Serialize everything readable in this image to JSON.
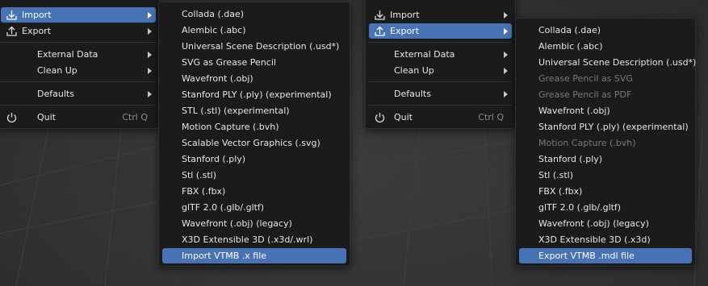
{
  "colors": {
    "highlight": "#4772b3",
    "menu_bg": "#1b1b1b",
    "disabled_text": "#7a7a7a"
  },
  "file_menu_left": {
    "items": [
      {
        "label": "Import",
        "icon": "import-icon"
      },
      {
        "label": "Export",
        "icon": "export-icon"
      },
      {
        "label": "External Data"
      },
      {
        "label": "Clean Up"
      },
      {
        "label": "Defaults"
      },
      {
        "label": "Quit",
        "icon": "power-icon",
        "shortcut": "Ctrl Q"
      }
    ]
  },
  "import_submenu": {
    "items": [
      "Collada (.dae)",
      "Alembic (.abc)",
      "Universal Scene Description (.usd*)",
      "SVG as Grease Pencil",
      "Wavefront (.obj)",
      "Stanford PLY (.ply) (experimental)",
      "STL (.stl) (experimental)",
      "Motion Capture (.bvh)",
      "Scalable Vector Graphics (.svg)",
      "Stanford (.ply)",
      "Stl (.stl)",
      "FBX (.fbx)",
      "glTF 2.0 (.glb/.gltf)",
      "Wavefront (.obj) (legacy)",
      "X3D Extensible 3D (.x3d/.wrl)",
      "Import VTMB .x file"
    ]
  },
  "file_menu_right": {
    "items": [
      {
        "label": "Import",
        "icon": "import-icon"
      },
      {
        "label": "Export",
        "icon": "export-icon"
      },
      {
        "label": "External Data"
      },
      {
        "label": "Clean Up"
      },
      {
        "label": "Defaults"
      },
      {
        "label": "Quit",
        "icon": "power-icon",
        "shortcut": "Ctrl Q"
      }
    ]
  },
  "export_submenu": {
    "items": [
      "Collada (.dae)",
      "Alembic (.abc)",
      "Universal Scene Description (.usd*)",
      "Grease Pencil as SVG",
      "Grease Pencil as PDF",
      "Wavefront (.obj)",
      "Stanford PLY (.ply) (experimental)",
      "Motion Capture (.bvh)",
      "Stanford (.ply)",
      "Stl (.stl)",
      "FBX (.fbx)",
      "glTF 2.0 (.glb/.gltf)",
      "Wavefront (.obj) (legacy)",
      "X3D Extensible 3D (.x3d)",
      "Export VTMB .mdl file"
    ]
  }
}
